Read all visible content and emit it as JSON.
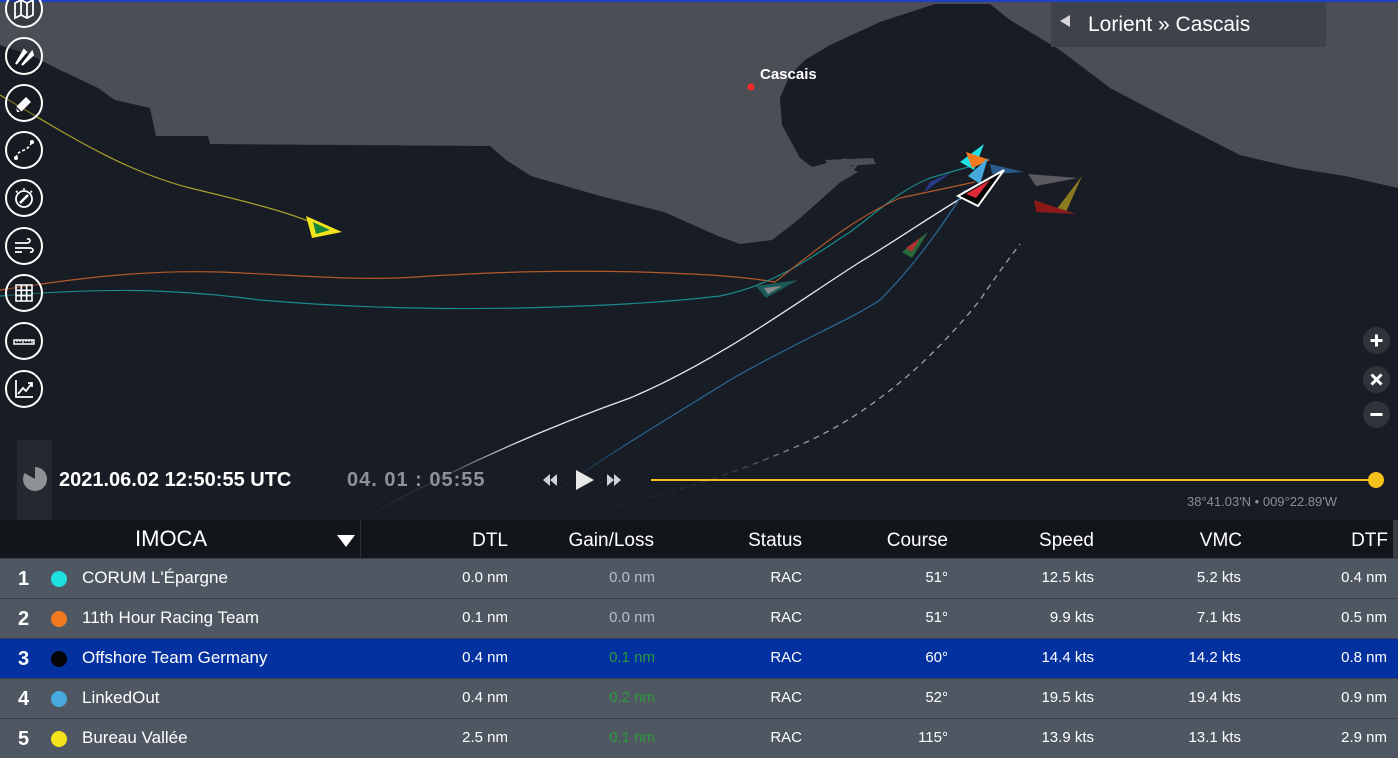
{
  "route": {
    "label": "Lorient » Cascais"
  },
  "map": {
    "city_label": "Cascais",
    "colors": {
      "sea": "#181c24",
      "land": "#4b4e55",
      "route_red": "#ff2a2a"
    }
  },
  "toolbar": {
    "items": [
      {
        "name": "map-layers-icon"
      },
      {
        "name": "boats-icon"
      },
      {
        "name": "eraser-icon"
      },
      {
        "name": "route-icon"
      },
      {
        "name": "compass-icon"
      },
      {
        "name": "wind-icon"
      },
      {
        "name": "grid-icon"
      },
      {
        "name": "ruler-icon"
      },
      {
        "name": "chart-icon"
      }
    ]
  },
  "zoom": {
    "in": "zoom-in-icon",
    "reset": "close-icon",
    "out": "zoom-out-icon"
  },
  "timeline": {
    "datetime": "2021.06.02 12:50:55 UTC",
    "elapsed": "04. 01 : 05:55",
    "progress": 1.0,
    "coords": "38°41.03'N • 009°22.89'W",
    "accent": "#f2c21b"
  },
  "table": {
    "class_label": "IMOCA",
    "headers": [
      "DTL",
      "Gain/Loss",
      "Status",
      "Course",
      "Speed",
      "VMC",
      "DTF"
    ],
    "rows": [
      {
        "rank": "1",
        "color": "#1fe0e0",
        "name": "CORUM L'Épargne",
        "dtl": "0.0 nm",
        "gain": "0.0 nm",
        "gain_pos": false,
        "status": "RAC",
        "course": "51°",
        "speed": "12.5 kts",
        "vmc": "5.2 kts",
        "dtf": "0.4 nm"
      },
      {
        "rank": "2",
        "color": "#f47a20",
        "name": "11th Hour Racing Team",
        "dtl": "0.1 nm",
        "gain": "0.0 nm",
        "gain_pos": false,
        "status": "RAC",
        "course": "51°",
        "speed": "9.9 kts",
        "vmc": "7.1 kts",
        "dtf": "0.5 nm"
      },
      {
        "rank": "3",
        "color": "#050505",
        "name": "Offshore Team Germany",
        "dtl": "0.4 nm",
        "gain": "0.1 nm",
        "gain_pos": true,
        "status": "RAC",
        "course": "60°",
        "speed": "14.4 kts",
        "vmc": "14.2 kts",
        "dtf": "0.8 nm",
        "selected": true
      },
      {
        "rank": "4",
        "color": "#48a9dc",
        "name": "LinkedOut",
        "dtl": "0.4 nm",
        "gain": "0.2 nm",
        "gain_pos": true,
        "status": "RAC",
        "course": "52°",
        "speed": "19.5 kts",
        "vmc": "19.4 kts",
        "dtf": "0.9 nm"
      },
      {
        "rank": "5",
        "color": "#f2e31b",
        "name": "Bureau Vallée",
        "dtl": "2.5 nm",
        "gain": "0.1 nm",
        "gain_pos": true,
        "status": "RAC",
        "course": "115°",
        "speed": "13.9 kts",
        "vmc": "13.1 kts",
        "dtf": "2.9 nm"
      }
    ]
  }
}
